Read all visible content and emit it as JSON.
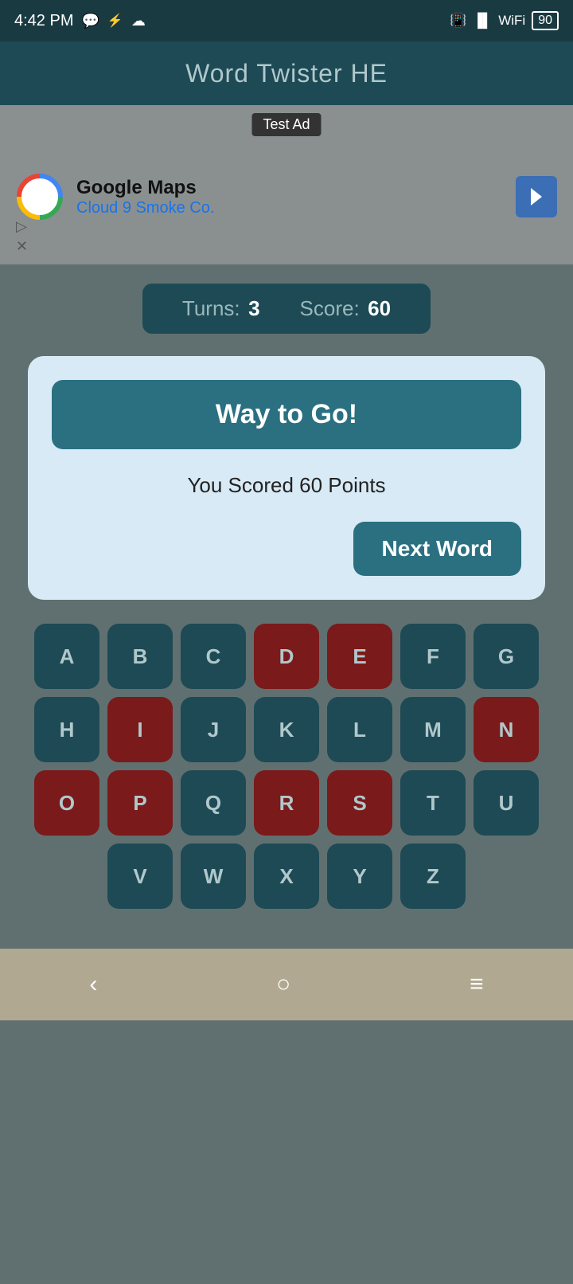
{
  "statusBar": {
    "time": "4:42 PM",
    "battery": "90"
  },
  "header": {
    "title": "Word Twister HE"
  },
  "ad": {
    "label": "Test Ad",
    "title": "Google Maps",
    "subtitle": "Cloud 9 Smoke Co."
  },
  "scoreBar": {
    "turnsLabel": "Turns:",
    "turnsValue": "3",
    "scoreLabel": "Score:",
    "scoreValue": "60"
  },
  "modal": {
    "wayToGoLabel": "Way to Go!",
    "scoredText": "You Scored 60 Points",
    "nextWordLabel": "Next Word"
  },
  "keyboard": {
    "rows": [
      [
        "A",
        "B",
        "C",
        "D",
        "E",
        "F",
        "G"
      ],
      [
        "H",
        "I",
        "J",
        "K",
        "L",
        "M",
        "N"
      ],
      [
        "O",
        "P",
        "Q",
        "R",
        "S",
        "T",
        "U"
      ],
      [
        "V",
        "W",
        "X",
        "Y",
        "Z"
      ]
    ],
    "usedLetters": [
      "D",
      "E",
      "I",
      "N",
      "O",
      "P",
      "R",
      "S"
    ]
  },
  "navBar": {
    "backLabel": "‹",
    "homeLabel": "○",
    "menuLabel": "≡"
  }
}
